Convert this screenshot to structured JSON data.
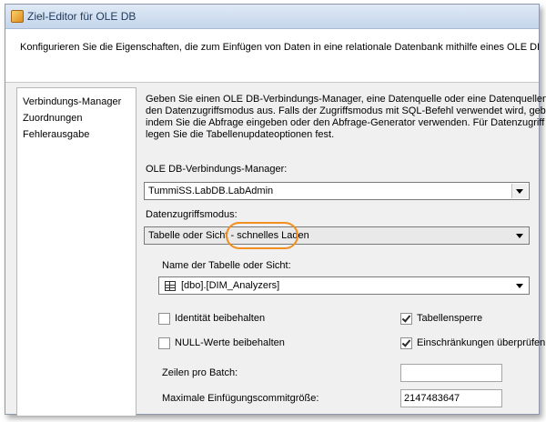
{
  "window": {
    "title": "Ziel-Editor für OLE DB"
  },
  "header": {
    "description": "Konfigurieren Sie die Eigenschaften, die zum Einfügen von Daten in eine relationale Datenbank mithilfe eines OLE DB-Anbi"
  },
  "nav": {
    "items": [
      "Verbindungs-Manager",
      "Zuordnungen",
      "Fehlerausgabe"
    ]
  },
  "content": {
    "info_lines": [
      "Geben Sie einen OLE DB-Verbindungs-Manager, eine Datenquelle oder eine Datenquellensich",
      "den Datenzugriffsmodus aus. Falls der Zugriffsmodus mit SQL-Befehl verwendet wird, geben",
      "indem Sie die Abfrage eingeben oder den Abfrage-Generator verwenden. Für Datenzugriff vo",
      "legen Sie die Tabellenupdateoptionen fest."
    ],
    "connection_label": "OLE DB-Verbindungs-Manager:",
    "connection_value": "TummiSS.LabDB.LabAdmin",
    "access_mode_label": "Datenzugriffsmodus:",
    "access_mode_value": "Tabelle oder Sicht - schnelles Laden",
    "table_label": "Name der Tabelle oder Sicht:",
    "table_value": "[dbo].[DIM_Analyzers]",
    "options": {
      "keep_identity": {
        "label": "Identität beibehalten",
        "checked": false
      },
      "keep_nulls": {
        "label": "NULL-Werte beibehalten",
        "checked": false
      },
      "table_lock": {
        "label": "Tabellensperre",
        "checked": true
      },
      "check_constraints": {
        "label": "Einschränkungen überprüfen",
        "checked": true
      }
    },
    "rows_per_batch_label": "Zeilen pro Batch:",
    "rows_per_batch_value": "",
    "max_commit_label": "Maximale Einfügungscommitgröße:",
    "max_commit_value": "2147483647"
  },
  "colors": {
    "highlight": "#f28f1f",
    "titlebar": "#c5d6eb"
  }
}
